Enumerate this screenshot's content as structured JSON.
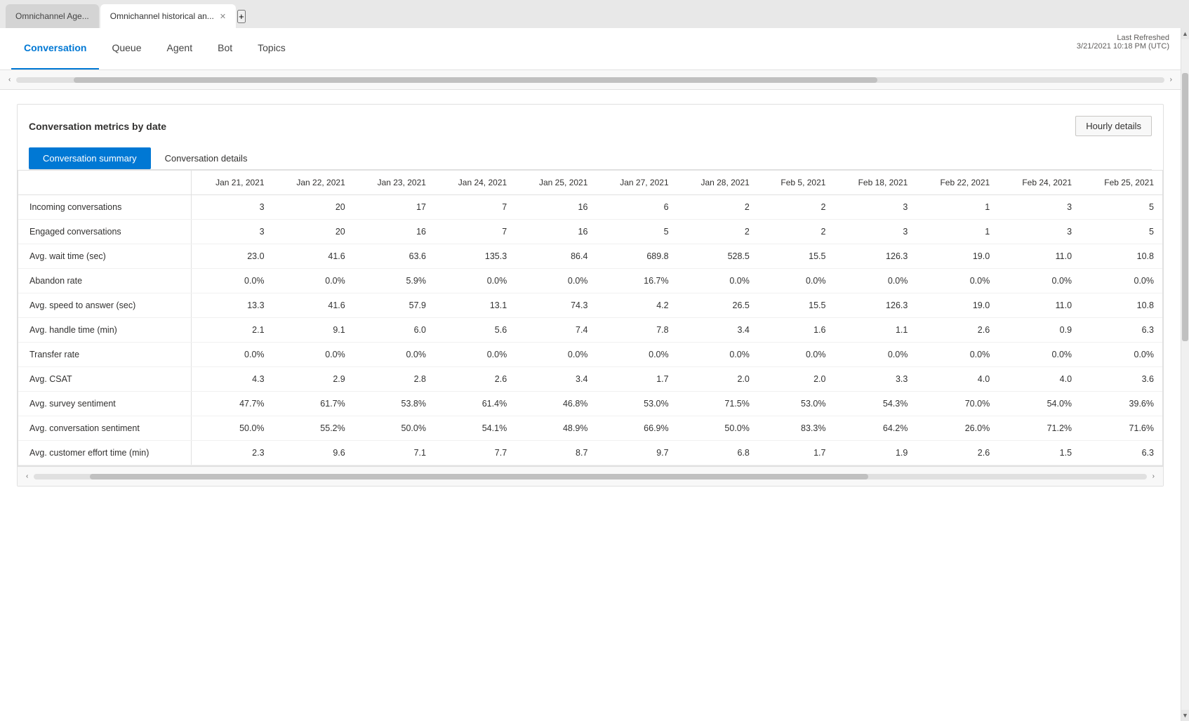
{
  "browser": {
    "tabs": [
      {
        "id": "tab1",
        "label": "Omnichannel Age...",
        "active": false
      },
      {
        "id": "tab2",
        "label": "Omnichannel historical an...",
        "active": true
      }
    ],
    "add_tab_label": "+"
  },
  "nav": {
    "tabs": [
      {
        "id": "conversation",
        "label": "Conversation",
        "active": true
      },
      {
        "id": "queue",
        "label": "Queue",
        "active": false
      },
      {
        "id": "agent",
        "label": "Agent",
        "active": false
      },
      {
        "id": "bot",
        "label": "Bot",
        "active": false
      },
      {
        "id": "topics",
        "label": "Topics",
        "active": false
      }
    ],
    "last_refreshed_label": "Last Refreshed",
    "last_refreshed_value": "3/21/2021 10:18 PM (UTC)"
  },
  "section": {
    "title": "Conversation metrics by date",
    "hourly_button": "Hourly details",
    "sub_tabs": [
      {
        "id": "summary",
        "label": "Conversation summary",
        "active": true
      },
      {
        "id": "details",
        "label": "Conversation details",
        "active": false
      }
    ]
  },
  "table": {
    "columns": [
      "Jan 21, 2021",
      "Jan 22, 2021",
      "Jan 23, 2021",
      "Jan 24, 2021",
      "Jan 25, 2021",
      "Jan 27, 2021",
      "Jan 28, 2021",
      "Feb 5, 2021",
      "Feb 18, 2021",
      "Feb 22, 2021",
      "Feb 24, 2021",
      "Feb 25, 2021"
    ],
    "rows": [
      {
        "label": "Incoming conversations",
        "values": [
          "3",
          "20",
          "17",
          "7",
          "16",
          "6",
          "2",
          "2",
          "3",
          "1",
          "3",
          "5"
        ]
      },
      {
        "label": "Engaged conversations",
        "values": [
          "3",
          "20",
          "16",
          "7",
          "16",
          "5",
          "2",
          "2",
          "3",
          "1",
          "3",
          "5"
        ]
      },
      {
        "label": "Avg. wait time (sec)",
        "values": [
          "23.0",
          "41.6",
          "63.6",
          "135.3",
          "86.4",
          "689.8",
          "528.5",
          "15.5",
          "126.3",
          "19.0",
          "11.0",
          "10.8"
        ]
      },
      {
        "label": "Abandon rate",
        "values": [
          "0.0%",
          "0.0%",
          "5.9%",
          "0.0%",
          "0.0%",
          "16.7%",
          "0.0%",
          "0.0%",
          "0.0%",
          "0.0%",
          "0.0%",
          "0.0%"
        ]
      },
      {
        "label": "Avg. speed to answer (sec)",
        "values": [
          "13.3",
          "41.6",
          "57.9",
          "13.1",
          "74.3",
          "4.2",
          "26.5",
          "15.5",
          "126.3",
          "19.0",
          "11.0",
          "10.8"
        ]
      },
      {
        "label": "Avg. handle time (min)",
        "values": [
          "2.1",
          "9.1",
          "6.0",
          "5.6",
          "7.4",
          "7.8",
          "3.4",
          "1.6",
          "1.1",
          "2.6",
          "0.9",
          "6.3"
        ]
      },
      {
        "label": "Transfer rate",
        "values": [
          "0.0%",
          "0.0%",
          "0.0%",
          "0.0%",
          "0.0%",
          "0.0%",
          "0.0%",
          "0.0%",
          "0.0%",
          "0.0%",
          "0.0%",
          "0.0%"
        ]
      },
      {
        "label": "Avg. CSAT",
        "values": [
          "4.3",
          "2.9",
          "2.8",
          "2.6",
          "3.4",
          "1.7",
          "2.0",
          "2.0",
          "3.3",
          "4.0",
          "4.0",
          "3.6"
        ]
      },
      {
        "label": "Avg. survey sentiment",
        "values": [
          "47.7%",
          "61.7%",
          "53.8%",
          "61.4%",
          "46.8%",
          "53.0%",
          "71.5%",
          "53.0%",
          "54.3%",
          "70.0%",
          "54.0%",
          "39.6%"
        ]
      },
      {
        "label": "Avg. conversation sentiment",
        "values": [
          "50.0%",
          "55.2%",
          "50.0%",
          "54.1%",
          "48.9%",
          "66.9%",
          "50.0%",
          "83.3%",
          "64.2%",
          "26.0%",
          "71.2%",
          "71.6%"
        ]
      },
      {
        "label": "Avg. customer effort time (min)",
        "values": [
          "2.3",
          "9.6",
          "7.1",
          "7.7",
          "8.7",
          "9.7",
          "6.8",
          "1.7",
          "1.9",
          "2.6",
          "1.5",
          "6.3"
        ]
      }
    ]
  }
}
